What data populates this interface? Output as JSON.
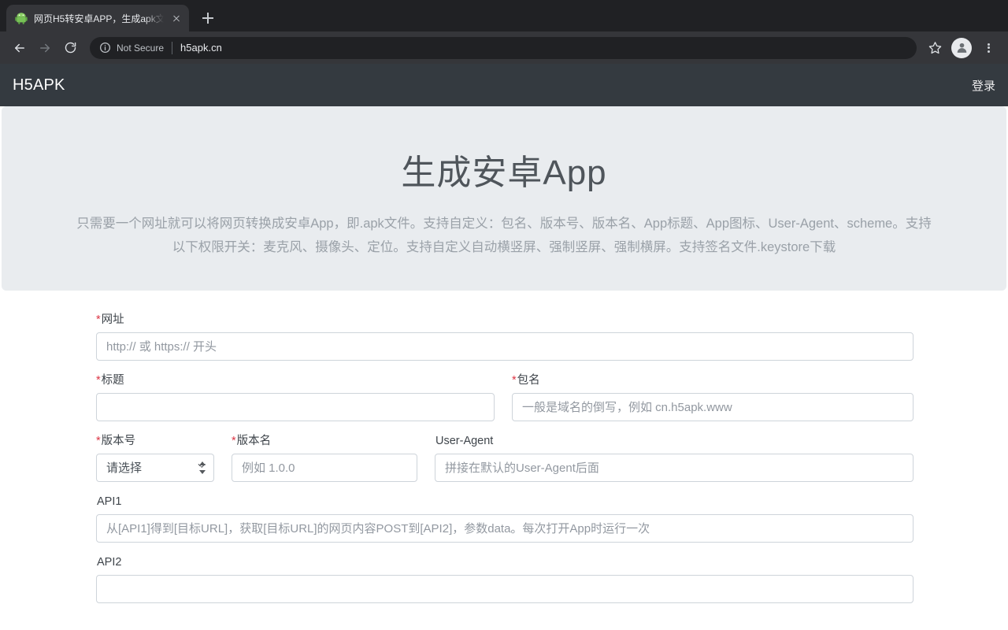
{
  "browser": {
    "tab": {
      "title": "网页H5转安卓APP，生成apk文",
      "favicon_name": "android-robot-favicon",
      "close_label": "close-tab"
    },
    "new_tab_label": "new-tab",
    "nav": {
      "back": "back-icon",
      "forward": "forward-icon",
      "reload": "reload-icon"
    },
    "omnibox": {
      "security_label": "Not Secure",
      "url": "h5apk.cn",
      "info_icon": "info-circle-icon"
    },
    "actions": {
      "bookmark": "star-icon",
      "profile": "profile-avatar-icon",
      "menu": "three-dot-menu-icon"
    }
  },
  "page": {
    "navbar": {
      "brand": "H5APK",
      "login": "登录"
    },
    "hero": {
      "title": "生成安卓App",
      "description": "只需要一个网址就可以将网页转换成安卓App，即.apk文件。支持自定义：包名、版本号、版本名、App标题、App图标、User-Agent、scheme。支持以下权限开关：麦克风、摄像头、定位。支持自定义自动横竖屏、强制竖屏、强制横屏。支持签名文件.keystore下载"
    },
    "form": {
      "url": {
        "label": "网址",
        "required_mark": "*",
        "value": "",
        "placeholder": "http:// 或 https:// 开头"
      },
      "title": {
        "label": "标题",
        "required_mark": "*",
        "value": "",
        "placeholder": ""
      },
      "package": {
        "label": "包名",
        "required_mark": "*",
        "value": "",
        "placeholder": "一般是域名的倒写，例如 cn.h5apk.www"
      },
      "version_code": {
        "label": "版本号",
        "required_mark": "*",
        "selected": "请选择",
        "options": [
          "请选择"
        ]
      },
      "version_name": {
        "label": "版本名",
        "required_mark": "*",
        "value": "",
        "placeholder": "例如 1.0.0"
      },
      "user_agent": {
        "label": "User-Agent",
        "required_mark": "",
        "value": "",
        "placeholder": "拼接在默认的User-Agent后面"
      },
      "api1": {
        "label": "API1",
        "required_mark": "",
        "value": "",
        "placeholder": "从[API1]得到[目标URL]，获取[目标URL]的网页内容POST到[API2]，参数data。每次打开App时运行一次"
      },
      "api2": {
        "label": "API2",
        "required_mark": ""
      }
    }
  },
  "colors": {
    "navbar_bg": "#343a40",
    "hero_bg": "#e9ecef",
    "required_red": "#dc3545",
    "border": "#ced4da",
    "chrome_dark": "#202124",
    "chrome_tab": "#35363a"
  }
}
